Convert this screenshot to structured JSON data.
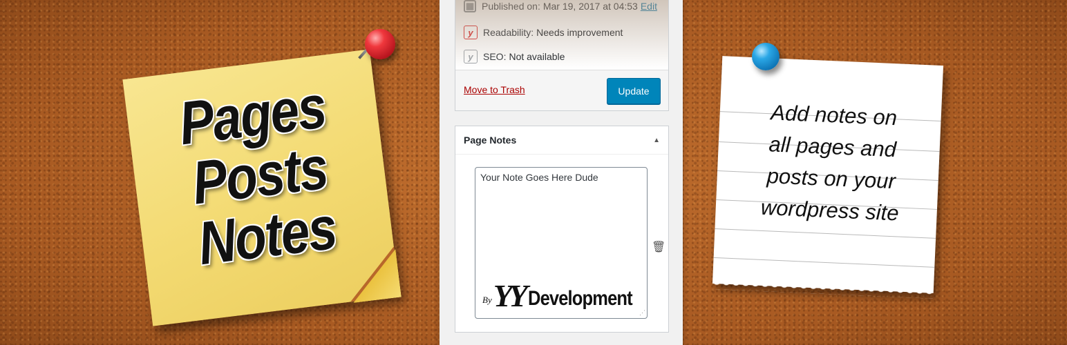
{
  "sticky_note": {
    "lines": [
      "Pages",
      "Posts",
      "Notes"
    ]
  },
  "publish": {
    "published_label": "Published on:",
    "published_date": "Mar 19, 2017 at 04:53",
    "edit_label": "Edit",
    "readability_label": "Readability:",
    "readability_value": "Needs improvement",
    "seo_label": "SEO:",
    "seo_value": "Not available",
    "trash_label": "Move to Trash",
    "update_label": "Update"
  },
  "page_notes": {
    "title": "Page Notes",
    "note_text": "Your Note Goes Here Dude",
    "brand_by": "By",
    "brand_mark": "YY",
    "brand_name": "Development"
  },
  "paper_note": {
    "lines": [
      "Add notes on",
      "all pages and",
      "posts on your",
      "wordpress site"
    ]
  },
  "colors": {
    "cork": "#b8672a",
    "sticky": "#f3da72",
    "update_button": "#0085ba",
    "trash_link": "#aa0000",
    "edit_link": "#0073aa",
    "red_pin": "#f0383d",
    "blue_pin": "#2aa7e6"
  },
  "icons": [
    "calendar-icon",
    "yoast-readability-icon",
    "yoast-seo-icon",
    "trash-icon",
    "resize-grip-icon",
    "collapse-arrow-icon"
  ]
}
